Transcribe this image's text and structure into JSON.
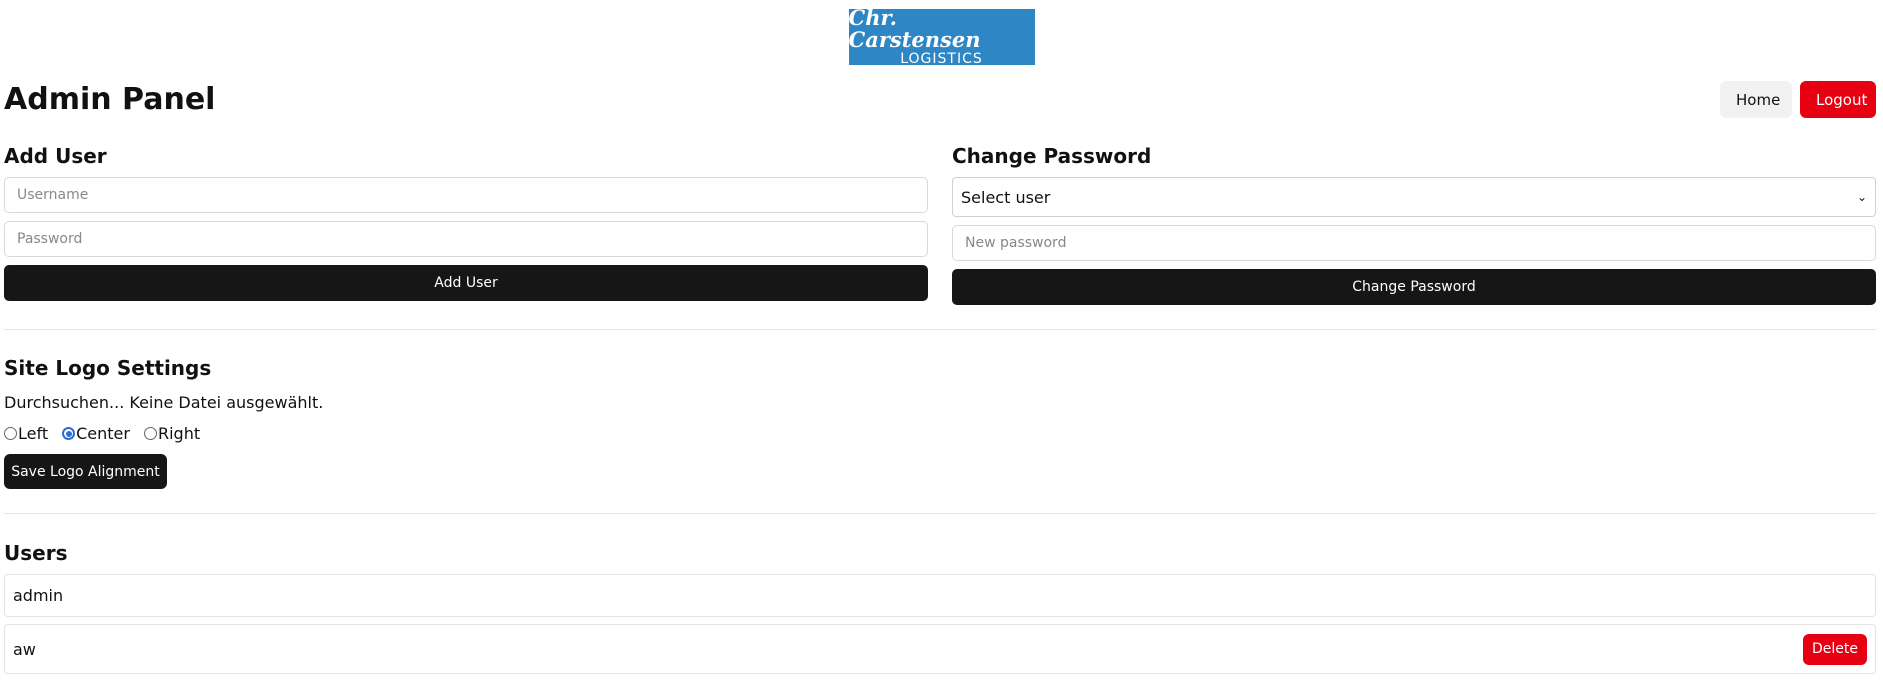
{
  "logo": {
    "line1": "Chr. Carstensen",
    "line2": "LOGISTICS"
  },
  "page": {
    "title": "Admin Panel"
  },
  "nav": {
    "home_label": "Home",
    "logout_label": "Logout"
  },
  "add_user": {
    "title": "Add User",
    "username_placeholder": "Username",
    "password_placeholder": "Password",
    "submit_label": "Add User"
  },
  "change_password": {
    "title": "Change Password",
    "select_value": "Select user",
    "new_password_placeholder": "New password",
    "submit_label": "Change Password"
  },
  "logo_settings": {
    "title": "Site Logo Settings",
    "file_text": "Durchsuchen... Keine Datei ausgewählt.",
    "options": [
      {
        "label": "Left",
        "checked": false
      },
      {
        "label": "Center",
        "checked": true
      },
      {
        "label": "Right",
        "checked": false
      }
    ],
    "save_label": "Save Logo Alignment"
  },
  "users": {
    "title": "Users",
    "rows": [
      {
        "name": "admin"
      },
      {
        "name": "aw",
        "delete_label": "Delete"
      }
    ]
  },
  "colors": {
    "logo_bg": "#2f86c4",
    "danger": "#e60012",
    "dark_button": "#161616",
    "radio_accent": "#2b6ed6"
  }
}
